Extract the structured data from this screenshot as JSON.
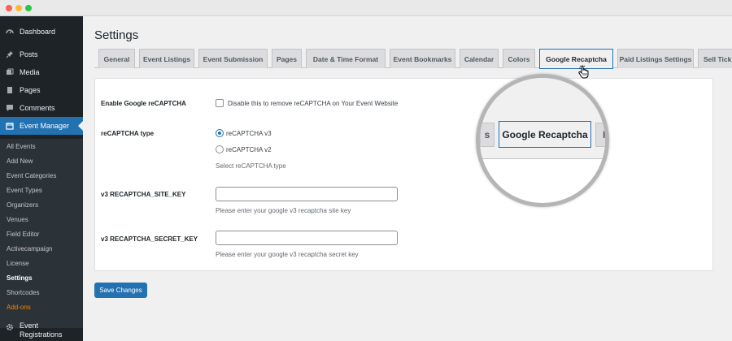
{
  "window": {
    "controls": [
      "close",
      "minimize",
      "maximize"
    ]
  },
  "sidebar": {
    "items": [
      {
        "label": "Dashboard",
        "icon": "dashboard-icon"
      },
      {
        "label": "Posts",
        "icon": "pin-icon"
      },
      {
        "label": "Media",
        "icon": "media-icon"
      },
      {
        "label": "Pages",
        "icon": "page-icon"
      },
      {
        "label": "Comments",
        "icon": "comment-icon"
      },
      {
        "label": "Event Manager",
        "icon": "calendar-icon",
        "active": true
      }
    ],
    "submenu": [
      "All Events",
      "Add New",
      "Event Categories",
      "Event Types",
      "Organizers",
      "Venues",
      "Field Editor",
      "Activecampaign",
      "License",
      "Settings",
      "Shortcodes",
      "Add-ons"
    ],
    "submenu_current": "Settings",
    "submenu_highlight": "Add-ons",
    "bottom_item": {
      "label": "Event Registrations",
      "icon": "gear-icon"
    }
  },
  "page": {
    "title": "Settings"
  },
  "tabs": [
    "General",
    "Event Listings",
    "Event Submission",
    "Pages",
    "Date & Time Format",
    "Event Bookmarks",
    "Calendar",
    "Colors",
    "Google Recaptcha",
    "Paid Listings Settings",
    "Sell Tick"
  ],
  "active_tab": "Google Recaptcha",
  "form": {
    "enable_label": "Enable Google reCAPTCHA",
    "enable_checkbox_label": "Disable this to remove reCAPTCHA on Your Event Website",
    "enable_checked": false,
    "type_label": "reCAPTCHA type",
    "type_options": [
      "reCAPTCHA v3",
      "reCAPTCHA v2"
    ],
    "type_selected": "reCAPTCHA v3",
    "type_description": "Select reCAPTCHA type",
    "site_key_label": "v3 RECAPTCHA_SITE_KEY",
    "site_key_value": "",
    "site_key_description": "Please enter your google v3 recaptcha site key",
    "secret_key_label": "v3 RECAPTCHA_SECRET_KEY",
    "secret_key_value": "",
    "secret_key_description": "Please enter your google v3 recaptcha secret key"
  },
  "save_button": "Save Changes",
  "magnifier": {
    "left_fragment": "s",
    "active_tab": "Google Recaptcha",
    "right_fragment": "P"
  },
  "colors": {
    "sidebar_bg": "#1d2327",
    "accent": "#2271b1",
    "highlight_orange": "#f18500"
  }
}
